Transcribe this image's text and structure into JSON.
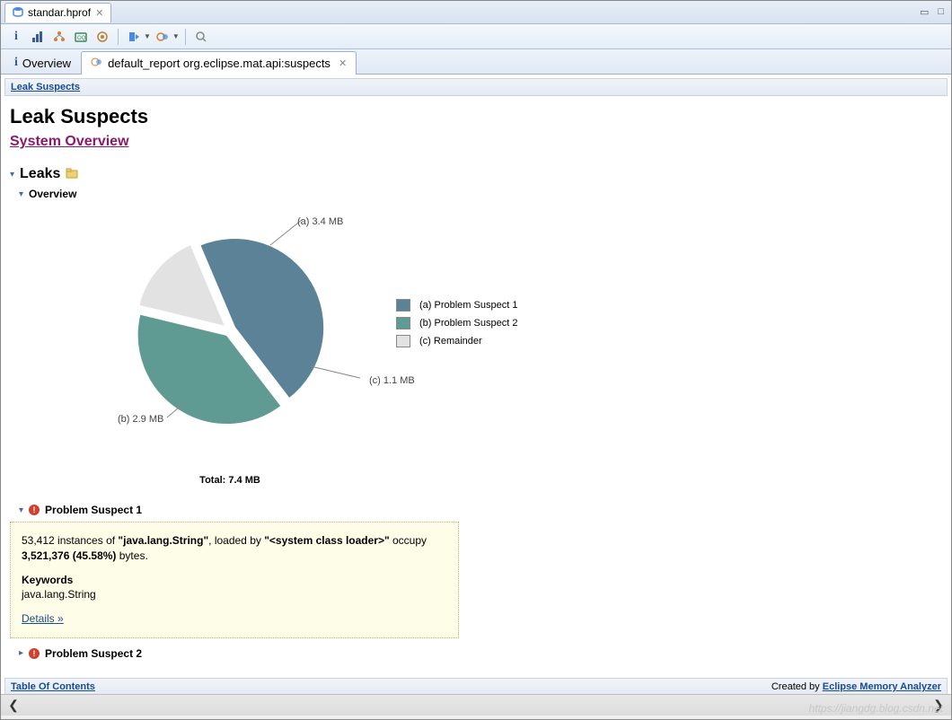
{
  "editor_tab": {
    "title": "standar.hprof"
  },
  "report_tabs": {
    "overview": "Overview",
    "active": "default_report  org.eclipse.mat.api:suspects"
  },
  "breadcrumb": {
    "leak_suspects": "Leak Suspects"
  },
  "page": {
    "title": "Leak Suspects",
    "system_overview": "System Overview"
  },
  "sections": {
    "leaks": "Leaks",
    "overview": "Overview",
    "suspect1": "Problem Suspect 1",
    "suspect2": "Problem Suspect 2"
  },
  "chart_data": {
    "type": "pie",
    "title": "Total: 7.4 MB",
    "series": [
      {
        "key": "(a)",
        "name": "Problem Suspect 1",
        "value": 3.4,
        "unit": "MB",
        "label": "(a)  3.4 MB",
        "color": "#5b8296"
      },
      {
        "key": "(b)",
        "name": "Problem Suspect 2",
        "value": 2.9,
        "unit": "MB",
        "label": "(b)  2.9 MB",
        "color": "#5f9b93"
      },
      {
        "key": "(c)",
        "name": "Remainder",
        "value": 1.1,
        "unit": "MB",
        "label": "(c)  1.1 MB",
        "color": "#e2e2e2"
      }
    ],
    "legend": [
      {
        "key": "(a)",
        "label": "(a)  Problem Suspect 1",
        "color": "#5b8296"
      },
      {
        "key": "(b)",
        "label": "(b)  Problem Suspect 2",
        "color": "#5f9b93"
      },
      {
        "key": "(c)",
        "label": "(c)  Remainder",
        "color": "#e2e2e2"
      }
    ]
  },
  "suspect1_detail": {
    "text1a": "53,412 instances of ",
    "text1b": "\"java.lang.String\"",
    "text1c": ", loaded by ",
    "text1d": "\"<system class loader>\"",
    "text1e": " occupy ",
    "text1f": "3,521,376 (45.58%)",
    "text1g": " bytes.",
    "keywords_label": "Keywords",
    "keywords_value": "java.lang.String",
    "details_link": "Details »"
  },
  "footer": {
    "toc": "Table Of Contents",
    "created_by": "Created by ",
    "tool_link": "Eclipse Memory Analyzer"
  },
  "watermark": "https://jiangdg.blog.csdn.net"
}
